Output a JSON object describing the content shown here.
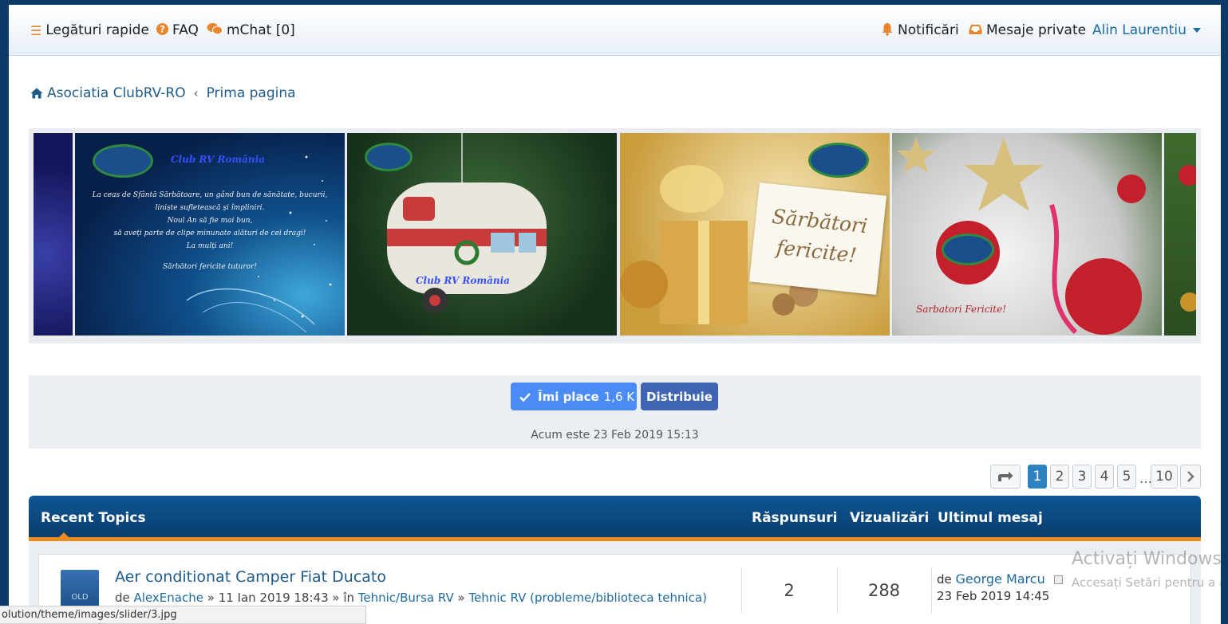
{
  "nav": {
    "quick_links": "Legături rapide",
    "faq": "FAQ",
    "mchat": "mChat [0]",
    "notifications": "Notificări",
    "private_messages": "Mesaje private",
    "user": "Alin Laurentiu"
  },
  "breadcrumb": {
    "home": "Asociatia ClubRV-RO",
    "current": "Prima pagina"
  },
  "slider": {
    "slide1": {
      "brand": "Club RV România",
      "lines": [
        "La ceas de Sfântă Sărbătoare, un gând bun de sănătate, bucurii,",
        "liniște sufletească și împliniri.",
        "Noul An să fie mai bun,",
        "să aveți parte de clipe minunate alături de cei dragi!",
        "La mulți ani!",
        "",
        "Sărbători fericite tuturor!"
      ]
    },
    "slide2": {
      "brand": "Club RV România"
    },
    "slide3": {
      "card_line1": "Sărbători",
      "card_line2": "fericite!"
    },
    "slide4": {
      "caption": "Sarbatori Fericite!"
    }
  },
  "social": {
    "like_label": "Îmi place",
    "like_count": "1,6 K",
    "share_label": "Distribuie"
  },
  "current_time": "Acum este 23 Feb 2019 15:13",
  "pagination": {
    "pages": [
      "1",
      "2",
      "3",
      "4",
      "5"
    ],
    "ellipsis": "…",
    "last": "10",
    "active": "1"
  },
  "recent_topics": {
    "title": "Recent Topics",
    "col_replies": "Răspunsuri",
    "col_views": "Vizualizări",
    "col_last": "Ultimul mesaj",
    "rows": [
      {
        "icon_label": "OLD",
        "title": "Aer conditionat Camper Fiat Ducato",
        "by": "de",
        "author": "AlexEnache",
        "date": "» 11 Ian 2019 18:43 » în",
        "forum_parent": "Tehnic/Bursa RV",
        "forum_sep": "»",
        "forum": "Tehnic RV (probleme/biblioteca tehnica)",
        "replies": "2",
        "views": "288",
        "last_by": "de",
        "last_author": "George Marcu",
        "last_date": "23 Feb 2019 14:45"
      }
    ]
  },
  "status_bar": "olution/theme/images/slider/3.jpg",
  "watermark": {
    "line1": "Activați Windows",
    "line2": "Accesați Setări pentru a activa Windows."
  }
}
